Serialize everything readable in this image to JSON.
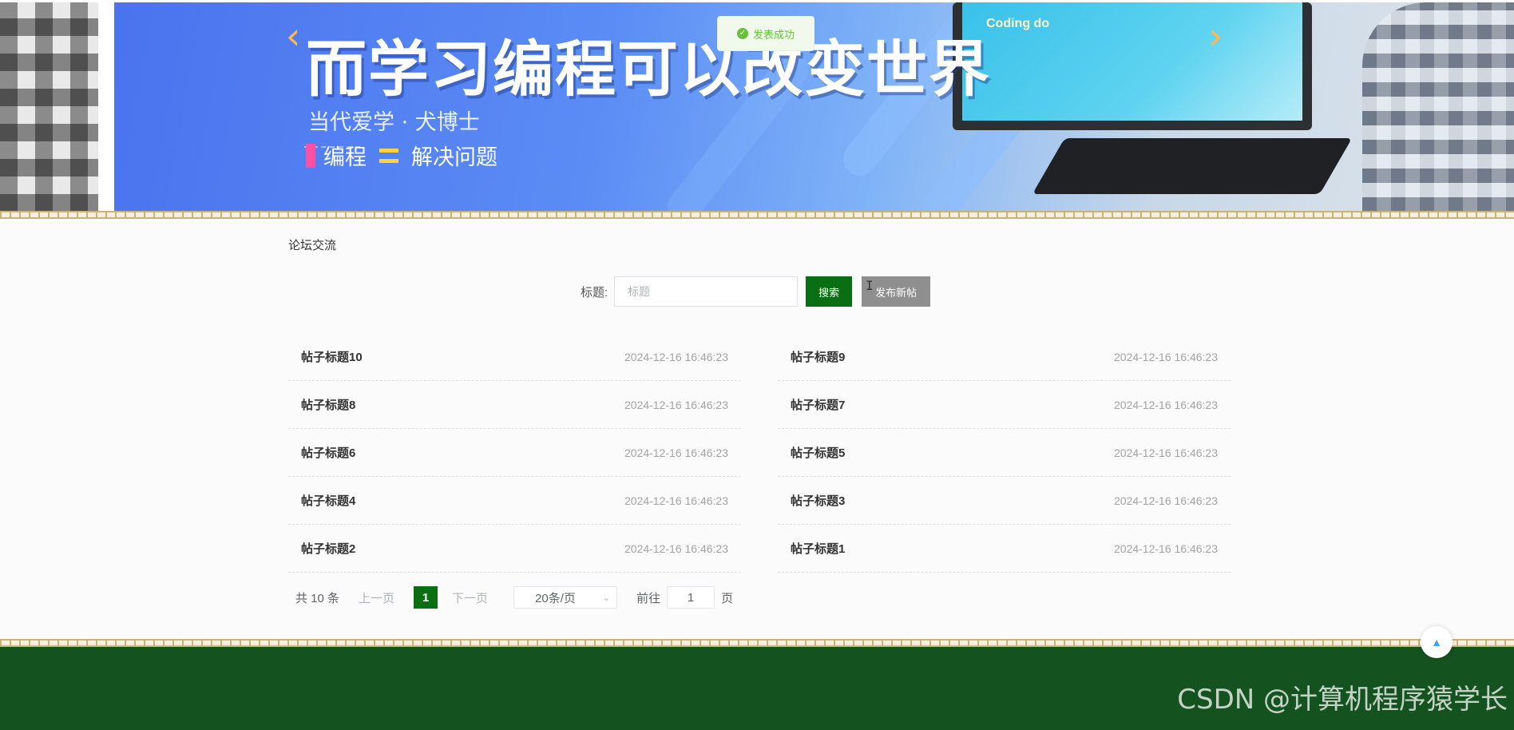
{
  "banner": {
    "headline": "而学习编程可以改变世界",
    "subtitle": "当代爱学 · 犬博士",
    "tagline_left": "编程",
    "tagline_right": "解决问题",
    "screen_text": "Coding do",
    "arrow_left_icon": "chevron-left-icon",
    "arrow_right_icon": "chevron-right-icon"
  },
  "toast": {
    "message": "发表成功",
    "icon": "check-circle-icon",
    "color": "#67c23a"
  },
  "section": {
    "title": "论坛交流"
  },
  "search": {
    "label": "标题:",
    "placeholder": "标题",
    "value": "",
    "search_button": "搜索",
    "publish_button": "发布新帖"
  },
  "posts": [
    {
      "title": "帖子标题10",
      "time": "2024-12-16 16:46:23"
    },
    {
      "title": "帖子标题9",
      "time": "2024-12-16 16:46:23"
    },
    {
      "title": "帖子标题8",
      "time": "2024-12-16 16:46:23"
    },
    {
      "title": "帖子标题7",
      "time": "2024-12-16 16:46:23"
    },
    {
      "title": "帖子标题6",
      "time": "2024-12-16 16:46:23"
    },
    {
      "title": "帖子标题5",
      "time": "2024-12-16 16:46:23"
    },
    {
      "title": "帖子标题4",
      "time": "2024-12-16 16:46:23"
    },
    {
      "title": "帖子标题3",
      "time": "2024-12-16 16:46:23"
    },
    {
      "title": "帖子标题2",
      "time": "2024-12-16 16:46:23"
    },
    {
      "title": "帖子标题1",
      "time": "2024-12-16 16:46:23"
    }
  ],
  "pagination": {
    "total": "共 10 条",
    "prev": "上一页",
    "current_page": "1",
    "next": "下一页",
    "page_size": "20条/页",
    "jump_label": "前往",
    "jump_value": "1",
    "jump_suffix": "页"
  },
  "footer": {
    "watermark": "CSDN @计算机程序猿学长"
  },
  "colors": {
    "primary_green": "#0a6e12",
    "footer_green": "#14521f",
    "publish_gray": "#8f8f8f",
    "border_gold": "#c8b277"
  }
}
